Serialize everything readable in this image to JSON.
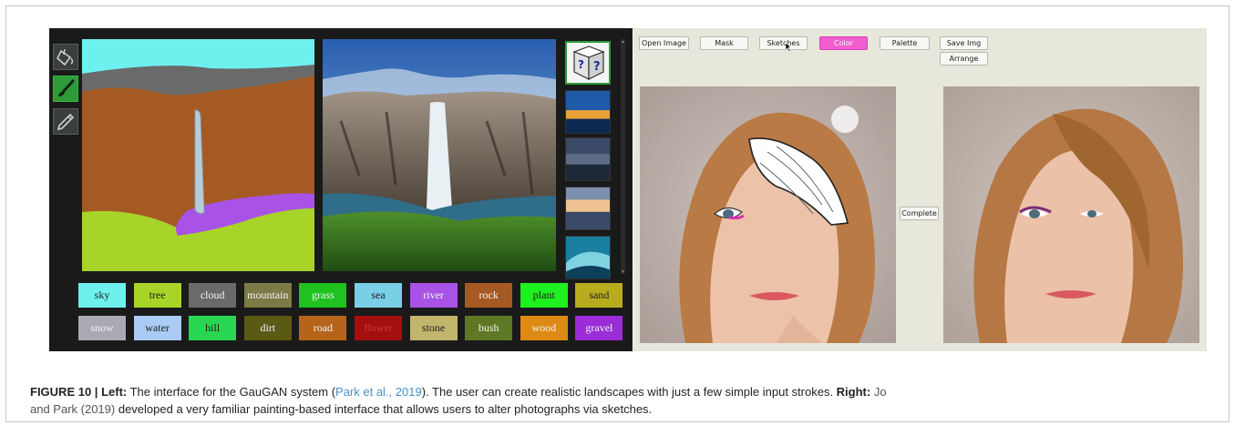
{
  "figure": {
    "label": "FIGURE 10",
    "separator": " | ",
    "left_heading": "Left:",
    "left_text_1": " The interface for the GauGAN system (",
    "left_cite": "Park et al., 2019",
    "left_text_2": "). The user can create realistic landscapes with just a few simple input strokes. ",
    "right_heading": "Right:",
    "right_cite_1": " Jo",
    "right_cite_2": "and Park (2019)",
    "right_text": " developed a very familiar painting-based interface that allows users to alter photographs via sketches."
  },
  "gaugan": {
    "tools": [
      {
        "name": "fill-bucket-icon"
      },
      {
        "name": "brush-icon"
      },
      {
        "name": "pencil-icon"
      }
    ],
    "labels": [
      {
        "text": "sky",
        "bg": "#6ef0ef",
        "fg": "#222222"
      },
      {
        "text": "tree",
        "bg": "#a8d42a",
        "fg": "#222222"
      },
      {
        "text": "cloud",
        "bg": "#6a6a6a",
        "fg": "#f2f2f2"
      },
      {
        "text": "mountain",
        "bg": "#7a7b46",
        "fg": "#f2f2f2"
      },
      {
        "text": "grass",
        "bg": "#1fc21f",
        "fg": "#f2f2f2"
      },
      {
        "text": "sea",
        "bg": "#79cfe6",
        "fg": "#222222"
      },
      {
        "text": "river",
        "bg": "#a853e6",
        "fg": "#f2f2f2"
      },
      {
        "text": "rock",
        "bg": "#a55a24",
        "fg": "#f2f2f2"
      },
      {
        "text": "plant",
        "bg": "#1ff01f",
        "fg": "#222222"
      },
      {
        "text": "sand",
        "bg": "#b8ac1e",
        "fg": "#222222"
      },
      {
        "text": "snow",
        "bg": "#a8a9b2",
        "fg": "#f2f2f2"
      },
      {
        "text": "water",
        "bg": "#a9cbf5",
        "fg": "#222222"
      },
      {
        "text": "hill",
        "bg": "#29d651",
        "fg": "#222222"
      },
      {
        "text": "dirt",
        "bg": "#5a5a14",
        "fg": "#f2f2f2"
      },
      {
        "text": "road",
        "bg": "#b5641a",
        "fg": "#f2f2f2"
      },
      {
        "text": "flower",
        "bg": "#a50e0e",
        "fg": "#c23a3a"
      },
      {
        "text": "stone",
        "bg": "#c2b56c",
        "fg": "#222222"
      },
      {
        "text": "bush",
        "bg": "#5e7826",
        "fg": "#f2f2f2"
      },
      {
        "text": "wood",
        "bg": "#dd8a14",
        "fg": "#f2f2f2"
      },
      {
        "text": "gravel",
        "bg": "#9a2dd6",
        "fg": "#f2f2f2"
      }
    ]
  },
  "sketch_ui": {
    "toolbar": {
      "open_image": "Open Image",
      "mask": "Mask",
      "sketches": "Sketches",
      "color": "Color",
      "palette": "Palette",
      "save_img": "Save Img",
      "arrange": "Arrange"
    },
    "complete": "Complete"
  }
}
